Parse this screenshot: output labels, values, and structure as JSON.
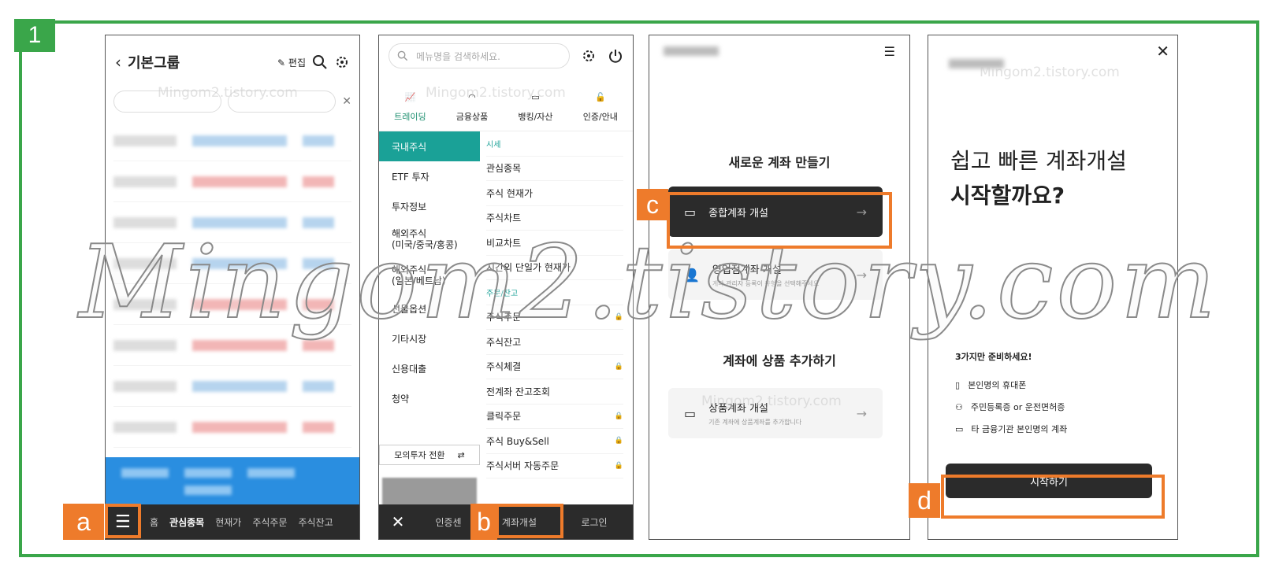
{
  "step_number": "1",
  "watermark": {
    "small": "Mingom2.tistory.com",
    "big": "Mingom2.tistory.com"
  },
  "callouts": {
    "a": "a",
    "b": "b",
    "c": "c",
    "d": "d"
  },
  "colors": {
    "frame": "#3aa64a",
    "callout": "#ee7b2b",
    "selected": "#1aa197",
    "dark": "#2b2b2b"
  },
  "panel1": {
    "title": "기본그룹",
    "edit": "편집",
    "nav": {
      "home": "홈",
      "watchlist": "관심종목",
      "price": "현재가",
      "order": "주식주문",
      "balance": "주식잔고"
    }
  },
  "panel2": {
    "search_placeholder": "메뉴명을 검색하세요.",
    "tabs": [
      "트레이딩",
      "금융상품",
      "뱅킹/자산",
      "인증/안내"
    ],
    "left_menu": [
      "국내주식",
      "ETF 투자",
      "투자정보",
      "해외주식\n(미국/중국/홍콩)",
      "해외주식\n(일본/베트남)",
      "선물옵션",
      "기타시장",
      "신용대출",
      "청약"
    ],
    "mock": "모의투자 전환",
    "right_menu": [
      {
        "label": "시세",
        "section": true
      },
      {
        "label": "관심종목"
      },
      {
        "label": "주식 현재가"
      },
      {
        "label": "주식차트"
      },
      {
        "label": "비교차트"
      },
      {
        "label": "시간외 단일가 현재가"
      },
      {
        "label": "주문/잔고",
        "section": true
      },
      {
        "label": "주식주문",
        "lock": true
      },
      {
        "label": "주식잔고"
      },
      {
        "label": "주식체결",
        "lock": true
      },
      {
        "label": "전계좌 잔고조회"
      },
      {
        "label": "클릭주문",
        "lock": true
      },
      {
        "label": "주식 Buy&Sell",
        "lock": true
      },
      {
        "label": "주식서버 자동주문",
        "lock": true
      }
    ],
    "nav": {
      "cert": "인증센",
      "open": "계좌개설",
      "login": "로그인"
    }
  },
  "panel3": {
    "heading1": "새로운 계좌 만들기",
    "btn1": "종합계좌 개설",
    "btn2": "영업점계좌 개설",
    "btn2_sub": "계좌 관리자 등록이 유형을 선택해주세요",
    "heading2": "계좌에 상품 추가하기",
    "btn3": "상품계좌 개설",
    "btn3_sub": "기존 계좌에 상품계좌를 추가합니다"
  },
  "panel4": {
    "line1": "쉽고 빠른 계좌개설",
    "line2": "시작할까요?",
    "prep": "3가지만 준비하세요!",
    "items": [
      "본인명의 휴대폰",
      "주민등록증 or 운전면허증",
      "타 금융기관 본인명의 계좌"
    ],
    "start": "시작하기"
  }
}
